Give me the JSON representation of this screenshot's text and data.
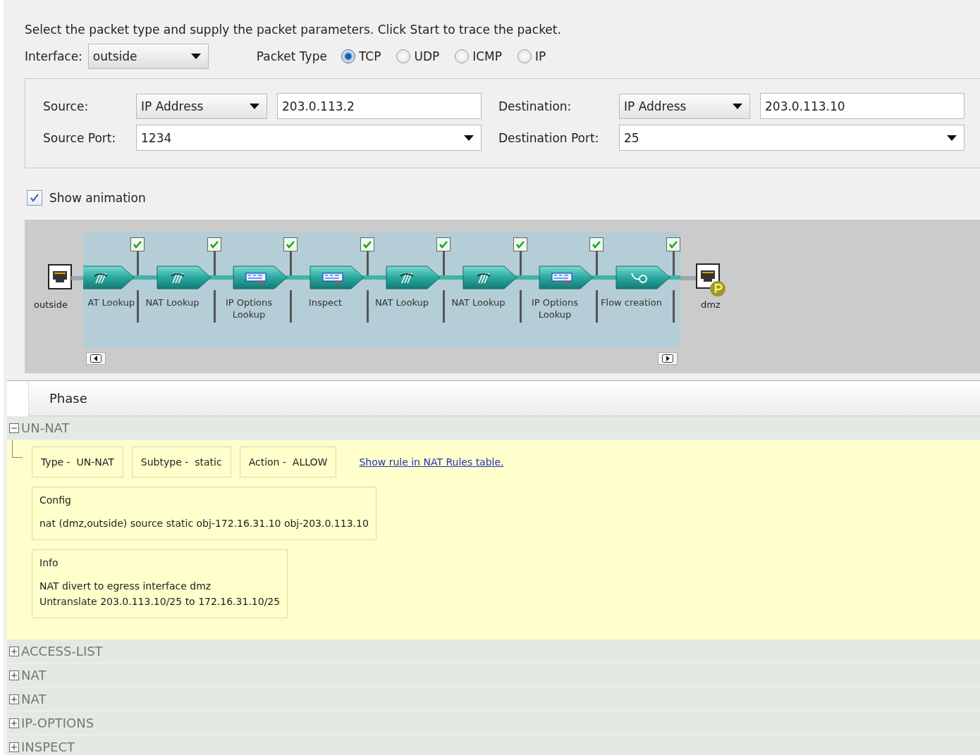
{
  "instruction": "Select the packet type and supply the packet parameters. Click Start to trace the packet.",
  "interface": {
    "label": "Interface:",
    "value": "outside"
  },
  "packet_type": {
    "label": "Packet Type",
    "options": [
      {
        "label": "TCP",
        "selected": true
      },
      {
        "label": "UDP",
        "selected": false
      },
      {
        "label": "ICMP",
        "selected": false
      },
      {
        "label": "IP",
        "selected": false
      }
    ]
  },
  "source": {
    "label": "Source:",
    "type": "IP Address",
    "value": "203.0.113.2"
  },
  "destination": {
    "label": "Destination:",
    "type": "IP Address",
    "value": "203.0.113.10"
  },
  "source_port": {
    "label": "Source Port:",
    "value": "1234"
  },
  "destination_port": {
    "label": "Destination Port:",
    "value": "25"
  },
  "show_animation": {
    "label": "Show animation",
    "checked": true
  },
  "trace": {
    "start_node": "outside",
    "end_node": "dmz",
    "stages": [
      {
        "label": "AT Lookup",
        "kind": "nat",
        "checked": true
      },
      {
        "label": "NAT Lookup",
        "kind": "nat",
        "checked": true
      },
      {
        "label": "IP Options Lookup",
        "kind": "options",
        "checked": true
      },
      {
        "label": "Inspect",
        "kind": "options",
        "checked": true
      },
      {
        "label": "NAT Lookup",
        "kind": "nat",
        "checked": true
      },
      {
        "label": "NAT Lookup",
        "kind": "nat",
        "checked": true
      },
      {
        "label": "IP Options Lookup",
        "kind": "options",
        "checked": true
      },
      {
        "label": "Flow creation",
        "kind": "flow",
        "checked": true
      }
    ]
  },
  "table": {
    "column": "Phase",
    "groups": [
      {
        "label": "UN-NAT",
        "expanded": true,
        "details": {
          "fields": [
            {
              "label": "Type -",
              "value": "UN-NAT"
            },
            {
              "label": "Subtype -",
              "value": "static"
            },
            {
              "label": "Action -",
              "value": "ALLOW"
            }
          ],
          "link": "Show rule in NAT Rules table.",
          "config": {
            "title": "Config",
            "lines": [
              "nat (dmz,outside) source static obj-172.16.31.10 obj-203.0.113.10"
            ]
          },
          "info": {
            "title": "Info",
            "lines": [
              "NAT divert to egress interface dmz",
              "Untranslate 203.0.113.10/25 to 172.16.31.10/25"
            ]
          }
        }
      },
      {
        "label": "ACCESS-LIST",
        "expanded": false
      },
      {
        "label": "NAT",
        "expanded": false
      },
      {
        "label": "NAT",
        "expanded": false
      },
      {
        "label": "IP-OPTIONS",
        "expanded": false
      },
      {
        "label": "INSPECT",
        "expanded": false
      }
    ]
  }
}
